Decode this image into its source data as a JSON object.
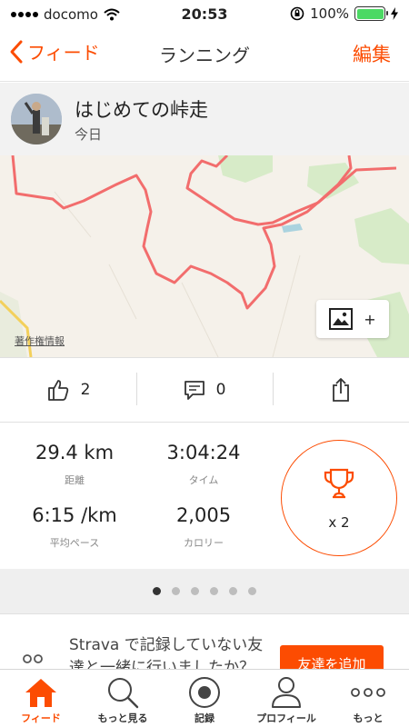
{
  "status_bar": {
    "carrier": "docomo",
    "time": "20:53",
    "battery": "100%"
  },
  "nav": {
    "back_label": "フィード",
    "title": "ランニング",
    "edit_label": "編集"
  },
  "activity": {
    "title": "はじめての峠走",
    "date": "今日"
  },
  "map": {
    "copyright": "著作権情報",
    "photo_add": "+"
  },
  "social": {
    "kudos_count": "2",
    "comment_count": "0"
  },
  "stats": {
    "distance": {
      "value": "29.4 km",
      "label": "距離"
    },
    "time": {
      "value": "3:04:24",
      "label": "タイム"
    },
    "pace": {
      "value": "6:15 /km",
      "label": "平均ペース"
    },
    "calories": {
      "value": "2,005",
      "label": "カロリー"
    },
    "achievements": "x 2"
  },
  "pager": {
    "count": 6,
    "active_index": 0
  },
  "promo": {
    "text": "Strava で記録していない友達と一緒に行いましたか？",
    "button": "友達を追加"
  },
  "tabs": [
    {
      "label": "フィード",
      "icon": "home-icon",
      "active": true
    },
    {
      "label": "もっと見る",
      "icon": "search-icon",
      "active": false
    },
    {
      "label": "記録",
      "icon": "record-icon",
      "active": false
    },
    {
      "label": "プロフィール",
      "icon": "profile-icon",
      "active": false
    },
    {
      "label": "もっと",
      "icon": "more-icon",
      "active": false
    }
  ],
  "colors": {
    "accent": "#fc4c02",
    "route": "#f26d6d",
    "map_bg": "#f5f1ea",
    "park": "#d7ebc8",
    "water": "#aad3df"
  }
}
